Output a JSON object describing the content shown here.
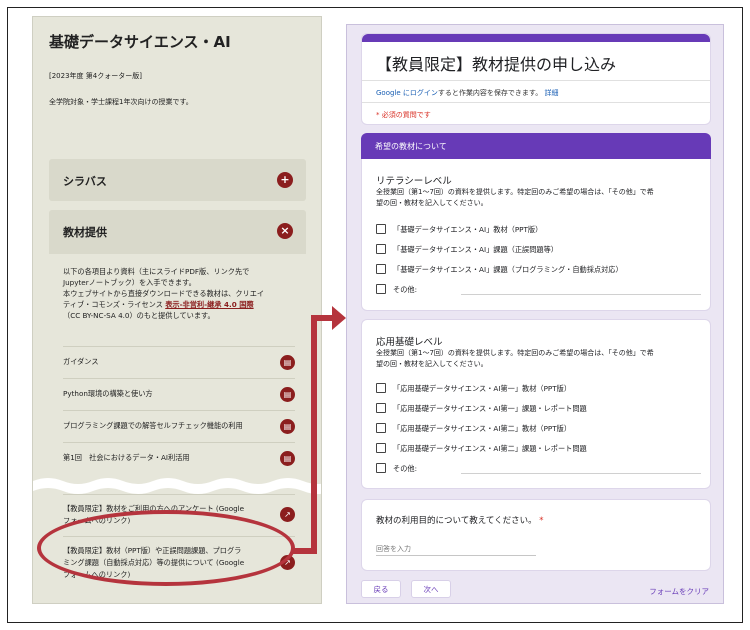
{
  "left": {
    "title": "基礎データサイエンス・AI",
    "edition": "[2023年度 第4クォーター版]",
    "audience": "全学院対象・学士課程1年次向けの授業です。",
    "syllabus_label": "シラバス",
    "syllabus_icon": "plus-icon",
    "materials_label": "教材提供",
    "materials_icon": "close-icon",
    "desc_line1": "以下の各項目より資料（主にスライドPDF版、リンク先で",
    "desc_line2": "Jupyterノートブック）を入手できます。",
    "desc_line3": "本ウェブサイトから直接ダウンロードできる教材は、クリエイ",
    "desc_line4_a": "ティブ・コモンズ・ライセンス ",
    "desc_line4_link": "表示-非営利-継承 4.0 国際",
    "desc_line5": "（CC BY-NC-SA 4.0）のもと提供しています。",
    "links": [
      {
        "label": "ガイダンス",
        "icon": "pdf-icon"
      },
      {
        "label": "Python環境の構築と使い方",
        "icon": "pdf-icon"
      },
      {
        "label": "プログラミング課題での解答セルフチェック機能の利用",
        "icon": "pdf-icon"
      },
      {
        "label": "第1回　社会におけるデータ・AI利活用",
        "icon": "pdf-icon"
      }
    ],
    "survey_line1": "【教員限定】教材をご利用の方へのアンケート (Google",
    "survey_line2": "フォームへのリンク)",
    "provide_line1": "【教員限定】教材（PPT版）や正誤問題課題、プログラ",
    "provide_line2": "ミング課題（自動採点対応）等の提供について (Google",
    "provide_line3": "フォームへのリンク)",
    "external_icon": "external-link-icon"
  },
  "form": {
    "title": "【教員限定】教材提供の申し込み",
    "login_link": "Google にログイン",
    "login_text": "すると作業内容を保存できます。",
    "login_detail": "詳細",
    "required_note": "* 必須の質問です",
    "section_header": "希望の教材について",
    "literacy_title": "リテラシーレベル",
    "literacy_desc1": "全授業回（第1～7回）の資料を提供します。特定回のみご希望の場合は、「その他」で希",
    "literacy_desc2": "望の回・教材を記入してください。",
    "literacy_options": [
      "「基礎データサイエンス・AI」教材（PPT版）",
      "「基礎データサイエンス・AI」課題（正誤問題等）",
      "「基礎データサイエンス・AI」課題（プログラミング・自動採点対応）",
      "その他:"
    ],
    "applied_title": "応用基礎レベル",
    "applied_desc1": "全授業回（第1～7回）の資料を提供します。特定回のみご希望の場合は、「その他」で希",
    "applied_desc2": "望の回・教材を記入してください。",
    "applied_options": [
      "「応用基礎データサイエンス・AI第一」教材（PPT版）",
      "「応用基礎データサイエンス・AI第一」課題・レポート問題",
      "「応用基礎データサイエンス・AI第二」教材（PPT版）",
      "「応用基礎データサイエンス・AI第二」課題・レポート問題",
      "その他:"
    ],
    "purpose_title": "教材の利用目的について教えてください。",
    "purpose_required": "*",
    "purpose_placeholder": "回答を入力",
    "back_button": "戻る",
    "next_button": "次へ",
    "clear_button": "フォームをクリア"
  },
  "colors": {
    "accent_red": "#8b1e1e",
    "highlight_red": "#b5343d",
    "form_purple": "#673ab7"
  }
}
